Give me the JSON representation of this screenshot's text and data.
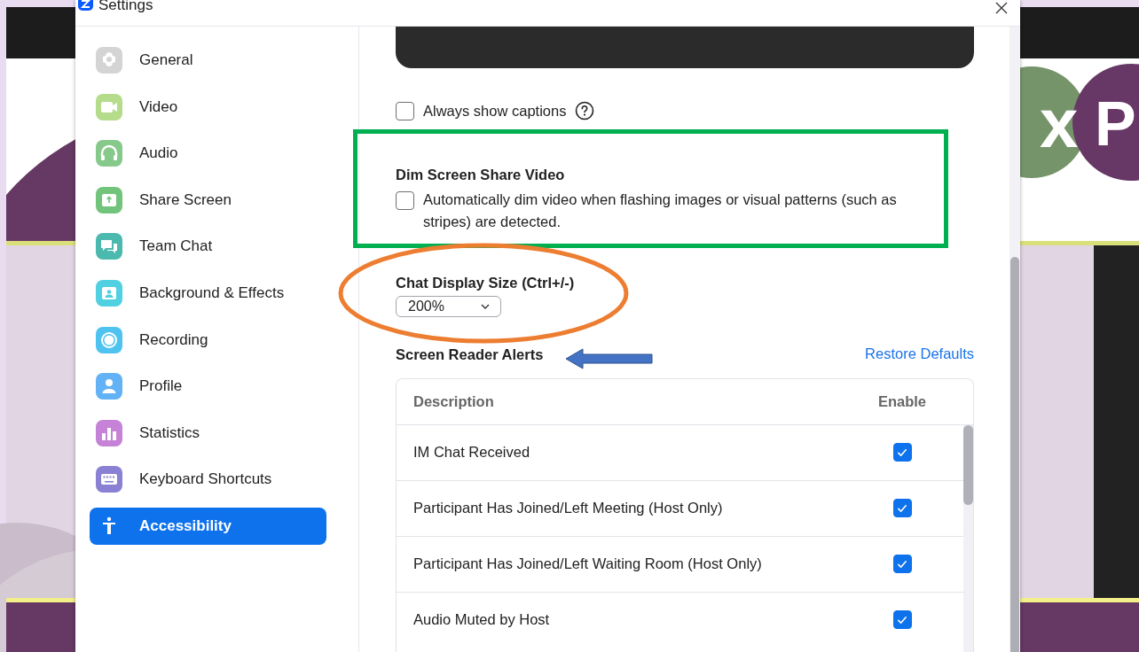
{
  "backdrop": {
    "logo_letters": [
      "x",
      "P"
    ]
  },
  "window": {
    "title": "Settings"
  },
  "sidebar": {
    "items": [
      {
        "label": "General",
        "kind": "gear",
        "color": "#d4d4d4",
        "selected": false
      },
      {
        "label": "Video",
        "kind": "video",
        "color": "#b4dc8a",
        "selected": false
      },
      {
        "label": "Audio",
        "kind": "headphones",
        "color": "#86c98b",
        "selected": false
      },
      {
        "label": "Share Screen",
        "kind": "share",
        "color": "#72c47c",
        "selected": false
      },
      {
        "label": "Team Chat",
        "kind": "chat",
        "color": "#4cb9ae",
        "selected": false
      },
      {
        "label": "Background & Effects",
        "kind": "portrait",
        "color": "#50d0e0",
        "selected": false
      },
      {
        "label": "Recording",
        "kind": "record",
        "color": "#4fc3f0",
        "selected": false
      },
      {
        "label": "Profile",
        "kind": "person",
        "color": "#62b2f5",
        "selected": false
      },
      {
        "label": "Statistics",
        "kind": "bars",
        "color": "#c682d6",
        "selected": false
      },
      {
        "label": "Keyboard Shortcuts",
        "kind": "keyboard",
        "color": "#8a80d4",
        "selected": false
      },
      {
        "label": "Accessibility",
        "kind": "accessibility",
        "selected": true
      }
    ]
  },
  "captions": {
    "always_show": {
      "label": "Always show captions",
      "checked": false
    }
  },
  "dim_screen_share": {
    "title": "Dim Screen Share Video",
    "option": {
      "label": "Automatically dim video when flashing images or visual patterns (such as stripes) are detected.",
      "checked": false
    }
  },
  "chat_display_size": {
    "label": "Chat Display Size (Ctrl+/-)",
    "value": "200%"
  },
  "screen_reader_alerts": {
    "title": "Screen Reader Alerts",
    "restore_link": "Restore Defaults",
    "columns": [
      "Description",
      "Enable"
    ],
    "rows": [
      {
        "description": "IM Chat Received",
        "checked": true
      },
      {
        "description": "Participant Has Joined/Left Meeting (Host Only)",
        "checked": true
      },
      {
        "description": "Participant Has Joined/Left Waiting Room (Host Only)",
        "checked": true
      },
      {
        "description": "Audio Muted by Host",
        "checked": true
      }
    ]
  }
}
